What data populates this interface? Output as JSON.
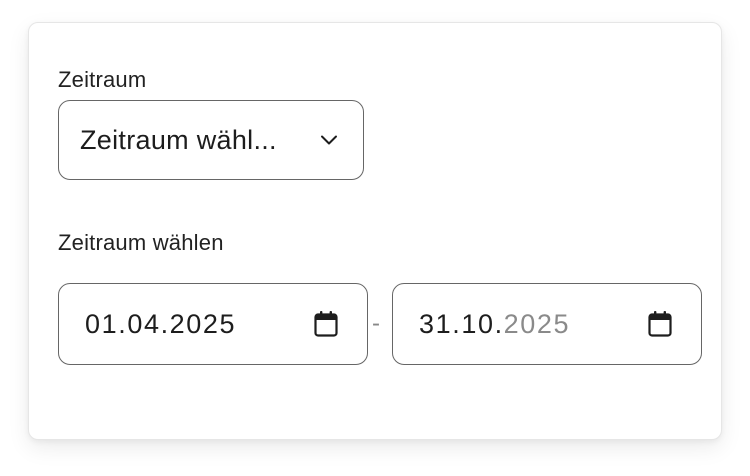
{
  "period": {
    "label": "Zeitraum",
    "select_value": "Zeitraum wähl..."
  },
  "range": {
    "label": "Zeitraum wählen",
    "start_date": "01.04.2025",
    "end_date_day_month": "31.10.",
    "end_date_year": "2025",
    "separator": "-"
  },
  "icons": {
    "select_chevron": "chevron-down-icon",
    "start_calendar": "calendar-icon",
    "end_calendar": "calendar-icon"
  },
  "colors": {
    "border": "#666666",
    "text": "#1d1d1d",
    "muted_text": "#8a8a8a"
  }
}
